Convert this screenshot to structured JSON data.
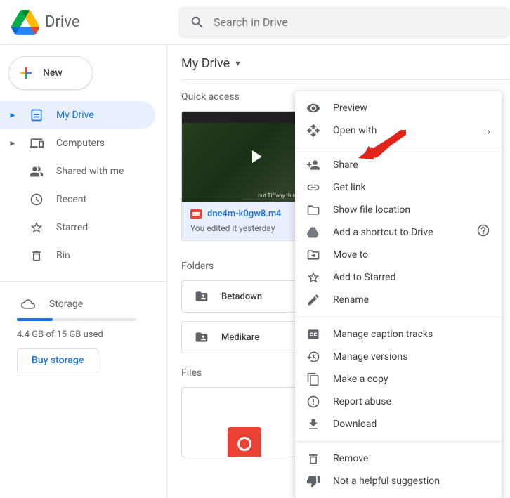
{
  "app": {
    "title": "Drive"
  },
  "search": {
    "placeholder": "Search in Drive"
  },
  "sidebar": {
    "new_label": "New",
    "items": [
      {
        "label": "My Drive",
        "icon": "my-drive",
        "active": true,
        "expandable": true
      },
      {
        "label": "Computers",
        "icon": "computers",
        "active": false,
        "expandable": true
      },
      {
        "label": "Shared with me",
        "icon": "shared",
        "active": false,
        "expandable": false
      },
      {
        "label": "Recent",
        "icon": "recent",
        "active": false,
        "expandable": false
      },
      {
        "label": "Starred",
        "icon": "starred",
        "active": false,
        "expandable": false
      },
      {
        "label": "Bin",
        "icon": "bin",
        "active": false,
        "expandable": false
      }
    ],
    "storage": {
      "label": "Storage",
      "used_text": "4.4 GB of 15 GB used",
      "buy_label": "Buy storage",
      "fill_percent": 30
    }
  },
  "breadcrumb": {
    "title": "My Drive"
  },
  "sections": {
    "quick_access": "Quick access",
    "folders": "Folders",
    "files": "Files"
  },
  "quick_card": {
    "filename": "dne4m-k0gw8.m4",
    "subtext": "You edited it yesterday",
    "thumb_caption": "but Tiffany thinks"
  },
  "folders": [
    {
      "name": "Betadown"
    },
    {
      "name": "Medikare"
    }
  ],
  "context_menu": {
    "preview": "Preview",
    "open_with": "Open with",
    "share": "Share",
    "get_link": "Get link",
    "show_location": "Show file location",
    "add_shortcut": "Add a shortcut to Drive",
    "move_to": "Move to",
    "add_starred": "Add to Starred",
    "rename": "Rename",
    "manage_captions": "Manage caption tracks",
    "manage_versions": "Manage versions",
    "make_copy": "Make a copy",
    "report_abuse": "Report abuse",
    "download": "Download",
    "remove": "Remove",
    "not_helpful": "Not a helpful suggestion"
  }
}
